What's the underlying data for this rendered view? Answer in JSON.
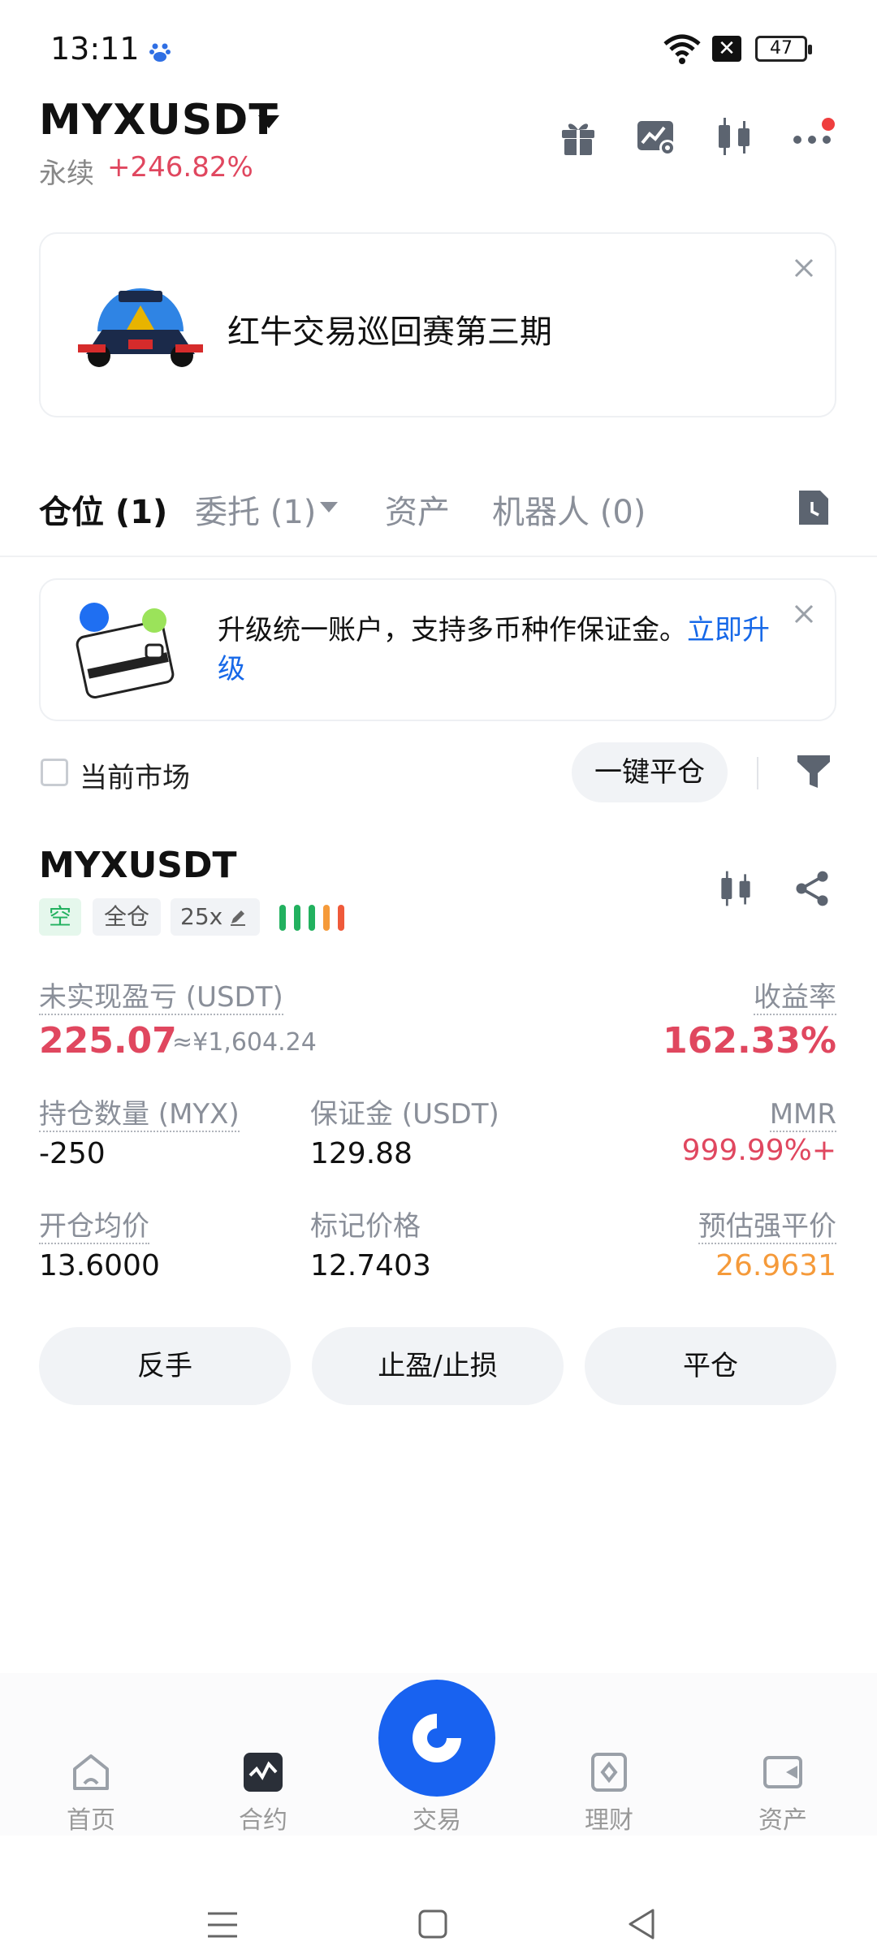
{
  "status_bar": {
    "time": "13:11",
    "battery": "47",
    "icons": [
      "baidu-icon",
      "wifi-icon",
      "notification-x-icon",
      "battery-icon"
    ]
  },
  "header": {
    "pair": "MYXUSDT",
    "type": "永续",
    "change": "+246.82%",
    "icons": [
      "gift-icon",
      "chart-settings-icon",
      "candlestick-icon",
      "more-icon"
    ]
  },
  "banner": {
    "text": "红牛交易巡回赛第三期"
  },
  "tabs": [
    {
      "label": "仓位 (1)"
    },
    {
      "label": "委托 (1)"
    },
    {
      "label": "资产"
    },
    {
      "label": "机器人 (0)"
    }
  ],
  "upgrade": {
    "text": "升级统一账户，支持多币种作保证金。",
    "link": "立即升级"
  },
  "filter": {
    "checkbox_label": "当前市场",
    "close_all": "一键平仓"
  },
  "position": {
    "symbol": "MYXUSDT",
    "side": "空",
    "margin_mode": "全仓",
    "leverage": "25x",
    "risk_colors": [
      "#22b15f",
      "#22b15f",
      "#22b15f",
      "#f59a3a",
      "#ef5a3a"
    ],
    "upnl_label": "未实现盈亏 (USDT)",
    "upnl_value": "225.07",
    "upnl_cny": "≈¥1,604.24",
    "roe_label": "收益率",
    "roe_value": "162.33%",
    "size_label": "持仓数量 (MYX)",
    "size_value": "-250",
    "margin_label": "保证金 (USDT)",
    "margin_value": "129.88",
    "mmr_label": "MMR",
    "mmr_value": "999.99%+",
    "entry_label": "开仓均价",
    "entry_value": "13.6000",
    "mark_label": "标记价格",
    "mark_value": "12.7403",
    "liq_label": "预估强平价",
    "liq_value": "26.9631"
  },
  "actions": {
    "reverse": "反手",
    "tpsl": "止盈/止损",
    "close": "平仓"
  },
  "bottom_nav": [
    {
      "label": "首页",
      "icon": "home-icon"
    },
    {
      "label": "合约",
      "icon": "futures-icon"
    },
    {
      "label": "交易",
      "icon": "gate-logo-icon"
    },
    {
      "label": "理财",
      "icon": "earn-icon"
    },
    {
      "label": "资产",
      "icon": "wallet-icon"
    }
  ]
}
